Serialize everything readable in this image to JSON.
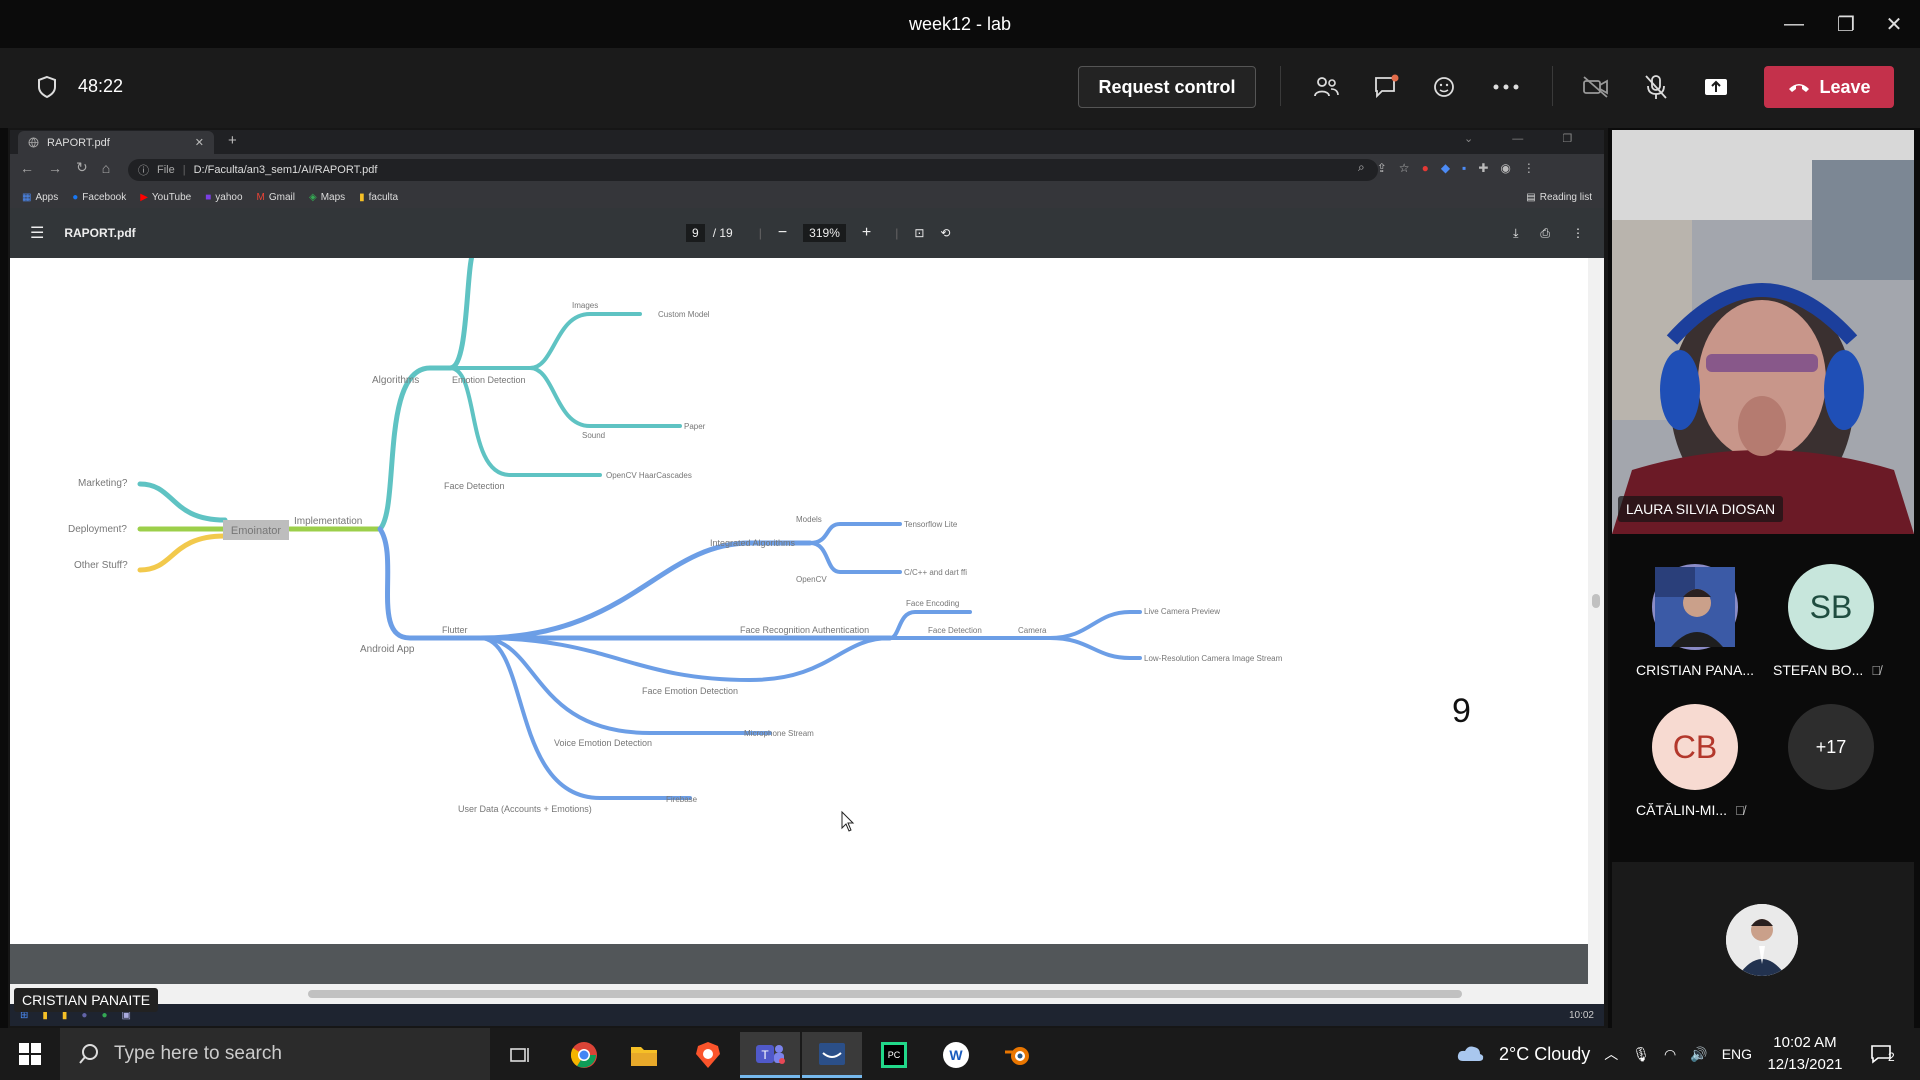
{
  "window": {
    "title": "week12 - lab"
  },
  "meeting": {
    "timer": "48:22",
    "request_control": "Request control",
    "leave": "Leave",
    "tools": [
      "people-icon",
      "chat-icon",
      "reactions-icon",
      "more-icon",
      "camera-off-icon",
      "mic-off-icon",
      "share-icon"
    ]
  },
  "browser": {
    "tab_title": "RAPORT.pdf",
    "url_prefix": "File",
    "url": "D:/Faculta/an3_sem1/AI/RAPORT.pdf",
    "bookmarks": [
      "Apps",
      "Facebook",
      "YouTube",
      "yahoo",
      "Gmail",
      "Maps",
      "faculta"
    ],
    "reading_list": "Reading list"
  },
  "pdf": {
    "filename": "RAPORT.pdf",
    "page_current": "9",
    "page_total": "/ 19",
    "zoom": "319%",
    "page_number_label": "9"
  },
  "mindmap": {
    "root": "Emoinator",
    "left": [
      "Marketing?",
      "Deployment?",
      "Other Stuff?"
    ],
    "implementation": "Implementation",
    "algorithms": "Algorithms",
    "emotion_detection": "Emotion Detection",
    "images": "Images",
    "custom_model": "Custom Model",
    "sound": "Sound",
    "paper": "Paper",
    "face_detection_algo": "Face Detection",
    "opencv_haar": "OpenCV HaarCascades",
    "android_app": "Android App",
    "flutter": "Flutter",
    "integrated_algorithms": "Integrated Algorithms",
    "models": "Models",
    "tflite": "Tensorflow Lite",
    "opencv": "OpenCV",
    "cpp_dart": "C/C++ and dart ffi",
    "face_rec_auth": "Face Recognition Authentication",
    "face_encoding": "Face Encoding",
    "face_detection_app": "Face Detection",
    "camera": "Camera",
    "live_preview": "Live Camera Preview",
    "low_res": "Low-Resolution Camera Image Stream",
    "face_emotion": "Face Emotion Detection",
    "voice_emotion": "Voice Emotion Detection",
    "mic_stream": "Microphone Stream",
    "user_data": "User Data (Accounts + Emotions)",
    "firebase": "Firebase"
  },
  "share": {
    "sharer_name": "CRISTIAN PANAITE",
    "inner_clock": "10:02"
  },
  "participants": {
    "video_name": "LAURA SILVIA DIOSAN",
    "p1_name": "CRISTIAN PANA...",
    "p2_initials": "SB",
    "p2_name": "STEFAN BO...",
    "p3_initials": "CB",
    "p3_name": "CĂTĂLIN-MI...",
    "more": "+17"
  },
  "taskbar": {
    "search_placeholder": "Type here to search",
    "weather": "2°C  Cloudy",
    "lang": "ENG",
    "time": "10:02 AM",
    "date": "12/13/2021",
    "notifications": "2"
  }
}
